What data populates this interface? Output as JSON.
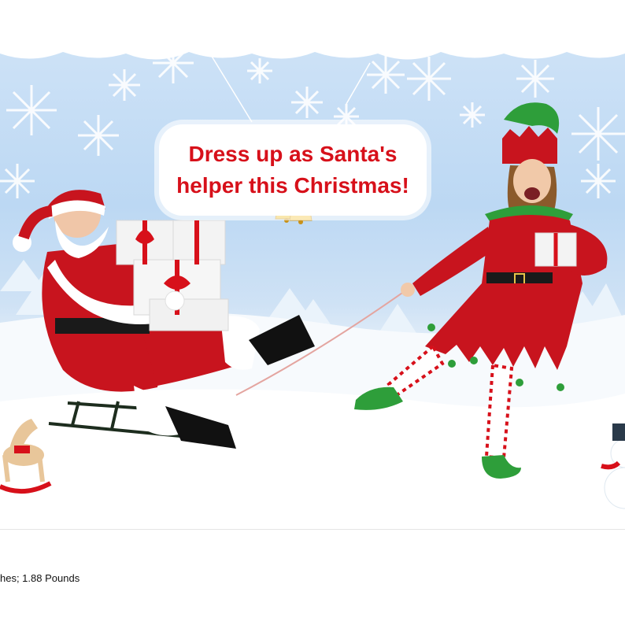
{
  "banner": {
    "headline_line1": "Dress up as Santa's",
    "headline_line2": "helper this Christmas!"
  },
  "product_details": {
    "dimensions_text": "hes; 1.88 Pounds"
  },
  "colors": {
    "headline_red": "#d7101a",
    "sky_blue": "#bcd8f3",
    "elf_green": "#2e9e3a",
    "santa_red": "#c8141e"
  },
  "icons": [
    "snowflake-icon",
    "bells-holly-icon",
    "rocking-horse-icon",
    "snowman-icon"
  ]
}
